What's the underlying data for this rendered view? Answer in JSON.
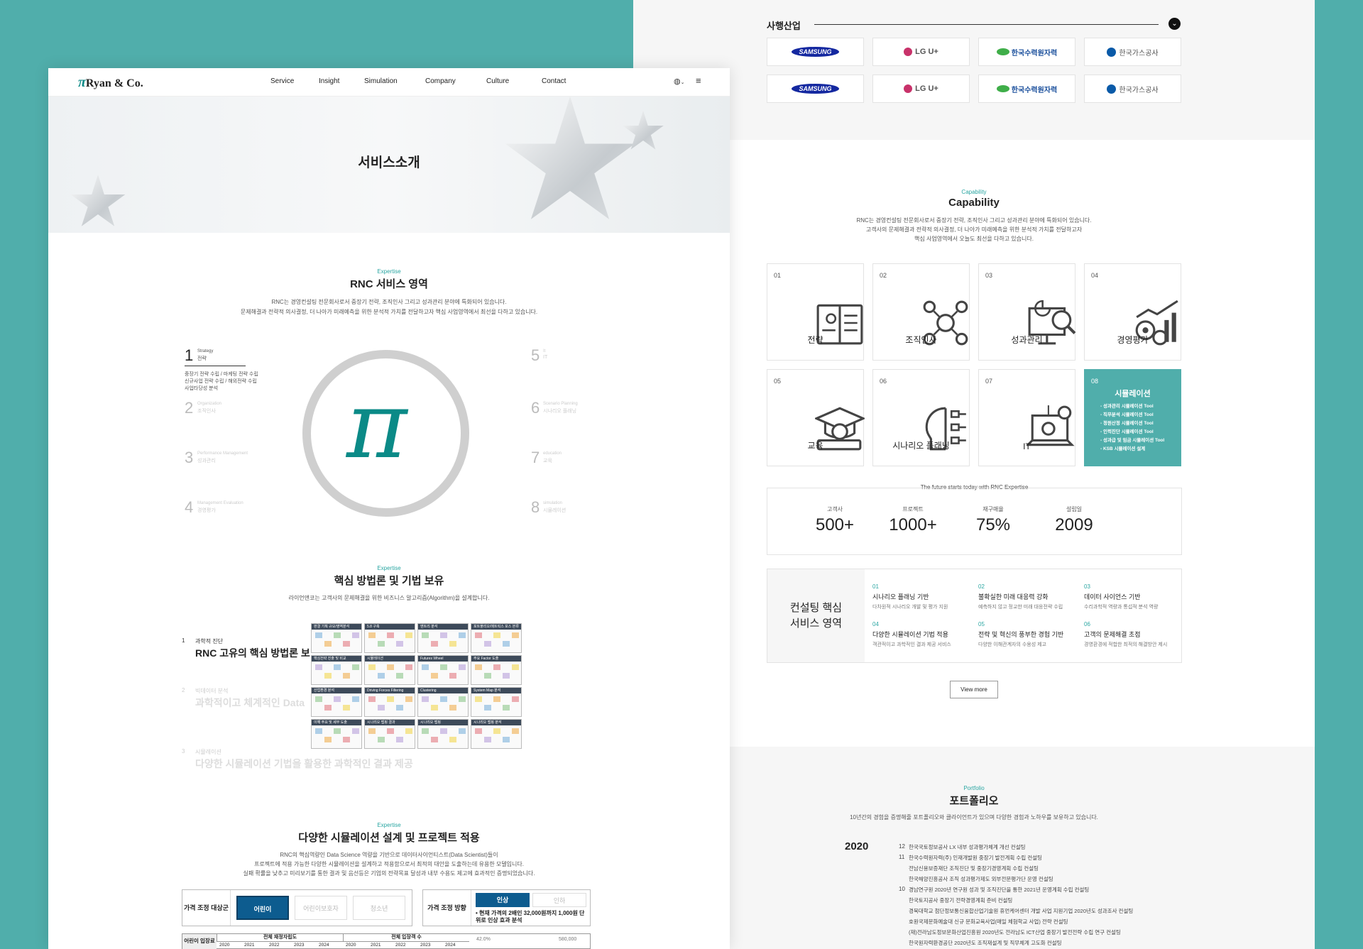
{
  "left": {
    "nav": {
      "logo_pi": "π",
      "logo_text": "Ryan & Co.",
      "menu": [
        "Service",
        "Insight",
        "Simulation",
        "Company",
        "Culture",
        "Contact"
      ],
      "lang_icon": "globe-icon",
      "menu_icon": "hamburger-icon"
    },
    "hero_title": "서비스소개",
    "expertise_section": {
      "eyebrow": "Expertise",
      "title": "RNC 서비스 영역",
      "desc1": "RNC는 경영컨설팅 전문회사로서 중장기 전략, 조직인사 그리고 성과관리 분야에 특화되어 있습니다.",
      "desc2": "문제해결과 전략적 의사결정, 더 나아가 미래예측을 위한 분석적 가치를 전달하고자 핵심 사업영역에서 최선을 다하고 있습니다."
    },
    "areas_left": [
      {
        "num": "1",
        "en": "Strategy",
        "ko": "전략",
        "items": [
          "중장기 전략 수립 / 마케팅 전략 수립",
          "신규사업 전략 수립 / 해외전략 수립",
          "사업타당성 분석"
        ]
      },
      {
        "num": "2",
        "en": "Organization",
        "ko": "조직인사"
      },
      {
        "num": "3",
        "en": "Performance Management",
        "ko": "성과관리"
      },
      {
        "num": "4",
        "en": "Management Evaluation",
        "ko": "경영평가"
      }
    ],
    "areas_right": [
      {
        "num": "5",
        "en": "It",
        "ko": "IT"
      },
      {
        "num": "6",
        "en": "Scenario Planning",
        "ko": "시나리오 플래닝"
      },
      {
        "num": "7",
        "en": "education",
        "ko": "교육"
      },
      {
        "num": "8",
        "en": "simulation",
        "ko": "시뮬레이션"
      }
    ],
    "center_logo": "π",
    "method_section": {
      "eyebrow": "Expertise",
      "title": "핵심 방법론 및 기법 보유",
      "desc": "라이언앤코는 고객사의 문제해결을 위한 비즈니스 알고리즘(Algorithm)을 설계합니다.",
      "items": [
        {
          "num": "1",
          "sub": "과학적 진단",
          "title": "RNC 고유의 핵심 방법론 보"
        },
        {
          "num": "2",
          "sub": "빅데이터 분석",
          "title": "과학적이고 체계적인 Data"
        },
        {
          "num": "3",
          "sub": "시뮬레이션",
          "title": "다양한 시뮬레이션 기법을 활용한 과학적인 결과 제공"
        }
      ],
      "thumbs": [
        "판결 기획 규모/영역분석",
        "5.8 구축",
        "엔트리 분석",
        "포트폴리오/매트릭스 포스 본류",
        "핵심전략 진출 및 비교",
        "시뮬레이션",
        "Futures Wheel",
        "주요 Factor 도출",
        "산업환경 분석",
        "Driving Forces Filtering",
        "Clustering",
        "System Map 분석",
        "이해 주요 및 세부 도출",
        "시나리오 맵핑 결과",
        "시나리오 맵핑",
        "시나리오 맵핑 분석"
      ]
    },
    "sim_section": {
      "eyebrow": "Expertise",
      "title": "다양한 시뮬레이션 설계 및 프로젝트 적용",
      "desc1": "RNC의 핵심역량인 Data Science 역량을 기반으로 데이터사이언티스트(Data Scientist)들이",
      "desc2": "프로젝트에 적용 가능한 다양한 시뮬레이션을 설계하고 적용함으로서 최적의 대안을 도출하는데 유용한 모델입니다.",
      "desc3": "실패 확률을 낮추고 미리보기를 통한 결과 및 음선등은 기업의 전략목표 달성과 내부 수용도 제고에 효과적인 증명되었습니다.",
      "target_label": "가격 조정 대상군",
      "targets": [
        "어린이",
        "어린이보호자",
        "청소년"
      ],
      "direction_label": "가격 조정 방향",
      "directions": [
        "인상",
        "인하"
      ],
      "note": "• 현재 가격의 2배인 32,000원까지 1,000원 단위로 인상 효과 분석",
      "row_label": "어린이 입장료",
      "col1": "전체 재정자립도",
      "col2": "전체 입장객 수",
      "years": [
        "2020",
        "2021",
        "2022",
        "2023",
        "2024"
      ],
      "range_min": "42.0%",
      "range_max": "580,000"
    }
  },
  "right": {
    "partners": {
      "title": "사행산업",
      "logos": [
        "SAMSUNG",
        "LG U+",
        "한국수력원자력",
        "한국가스공사",
        "SAMSUNG",
        "LG U+",
        "한국수력원자력",
        "한국가스공사"
      ]
    },
    "capability": {
      "eyebrow": "Capability",
      "title": "Capability",
      "desc1": "RNC는 경영컨설팅 전문회사로서 중장기 전략, 조직인사 그리고 성과관리 분야에 특화되어 있습니다.",
      "desc2": "고객사의 문제해결과 전략적 의사결정, 더 나아가 미래예측을 위한 분석적 가치를 전달하고자",
      "desc3": "핵심 사업영역에서 오늘도 최선을 다하고 있습니다.",
      "cards": [
        {
          "num": "01",
          "label": "전략",
          "icon": "book-icon"
        },
        {
          "num": "02",
          "label": "조직인사",
          "icon": "people-network-icon"
        },
        {
          "num": "03",
          "label": "성과관리",
          "icon": "monitor-analysis-icon"
        },
        {
          "num": "04",
          "label": "경영평가",
          "icon": "gears-chart-icon"
        },
        {
          "num": "05",
          "label": "교육",
          "icon": "graduation-cap-icon"
        },
        {
          "num": "06",
          "label": "시나리오 플래닝",
          "icon": "head-flow-icon"
        },
        {
          "num": "07",
          "label": "IT",
          "icon": "laptop-gear-icon"
        }
      ],
      "active_card": {
        "num": "08",
        "title": "시뮬레이션",
        "items": [
          "- 성과관리 시뮬레이션 Tool",
          "- 직무분석 시뮬레이션 Tool",
          "- 정원산정 시뮬레이션 Tool",
          "- 인력진단 시뮬레이션 Tool",
          "- 성과급 및 임금 시뮬레이션 Tool",
          "- KSB 시뮬레이션 설계"
        ]
      },
      "stats_title": "The future starts today with RNC Expertise",
      "stats": [
        {
          "label": "고객사",
          "value": "500+"
        },
        {
          "label": "프로젝트",
          "value": "1000+"
        },
        {
          "label": "재구매율",
          "value": "75%"
        },
        {
          "label": "설립일",
          "value": "2009"
        }
      ],
      "core_title": "컨설팅 핵심\n서비스 영역",
      "core_items": [
        {
          "num": "01",
          "title": "시나리오 플래닝 기반",
          "desc": "다차원적 시나리오 개발 및 평가 지원"
        },
        {
          "num": "02",
          "title": "불확실한 미래 대응력 강화",
          "desc": "예측하지 않고 정교한 미래 대응전략 수립"
        },
        {
          "num": "03",
          "title": "데이터 사이언스 기반",
          "desc": "수리과학적 역량과 통섭적 분석 역량"
        },
        {
          "num": "04",
          "title": "다양한 시뮬레이션 기법 적용",
          "desc": "객관적이고 과학적인 결과 제공 서비스"
        },
        {
          "num": "05",
          "title": "전략 및 혁신의 풍부한 경험 기반",
          "desc": "다양한 이해관계자의 수용성 제고"
        },
        {
          "num": "06",
          "title": "고객의 문제해결 초점",
          "desc": "경영환경에 적합한 최적의 해결방안 제시"
        }
      ],
      "view_more": "View more"
    },
    "portfolio": {
      "eyebrow": "Portfolio",
      "title": "포트폴리오",
      "desc": "10년간의 경험을 증명해줄 포트폴리오와 클라이언트가 있으며 다양한 경험과 노하우를 보유하고 있습니다.",
      "year": "2020",
      "entries": [
        {
          "month": "12",
          "text": "한국국토정보공사 LX 내부 성과평가체계 개선 컨설팅"
        },
        {
          "month": "11",
          "text": "한국수력원자력(주) 인재개발원 중장기 발전계획 수립 컨설팅"
        },
        {
          "month": "",
          "text": "전남신용보증재단 조직진단 및 중장기경영계획 수립 컨설팅"
        },
        {
          "month": "",
          "text": "한국해양진흥공사 조직 성과평가제도 외부전문평가단 운영 컨설팅"
        },
        {
          "month": "10",
          "text": "경남연구원 2020년 연구원 성과 및 조직진단을 통한 2021년 운영계획 수립 컨설팅"
        },
        {
          "month": "",
          "text": "한국토지공사 중장기 전략경영계획 준비 컨설팅"
        },
        {
          "month": "",
          "text": "경북대학교 첨단정보통신융합산업기술원 휴먼케어센터 개발 사업 지원기업 2020년도 성과조사 컨설팅"
        },
        {
          "month": "",
          "text": "호원국제문화예술대 신규 문화교육사업(매일 체험학교 사업) 전략 컨설팅"
        },
        {
          "month": "",
          "text": "(재)전라남도정보문화산업진흥원 2020년도 전라남도 ICT산업 중장기 발전전략 수립 연구 컨설팅"
        },
        {
          "month": "",
          "text": "한국원자력환경공단 2020년도 조직재설계 및 직무체계 고도화 컨설팅"
        }
      ]
    }
  }
}
